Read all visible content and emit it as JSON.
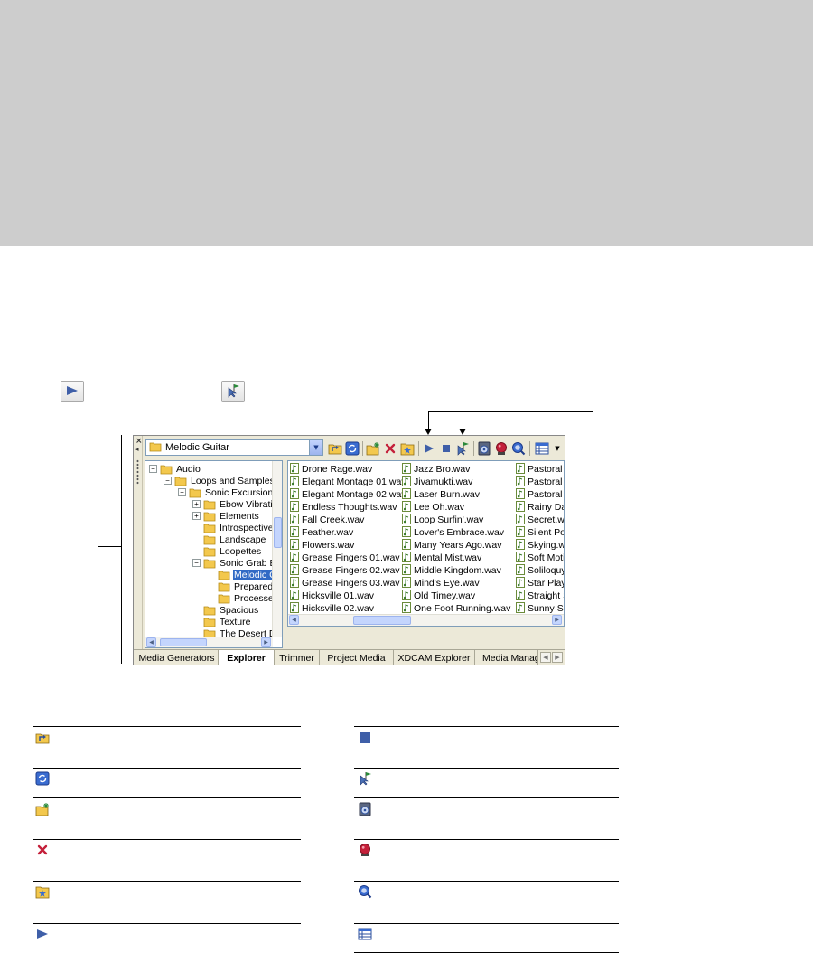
{
  "explorer": {
    "path": "Melodic Guitar",
    "tree": [
      {
        "label": "Audio",
        "expander": "⊟"
      },
      {
        "label": "Loops and Samples",
        "expander": "⊟"
      },
      {
        "label": "Sonic Excursions fo",
        "expander": "⊟"
      },
      {
        "label": "Ebow Vibration",
        "expander": "⊞"
      },
      {
        "label": "Elements",
        "expander": "⊞"
      },
      {
        "label": "Introspective",
        "expander": ""
      },
      {
        "label": "Landscape",
        "expander": ""
      },
      {
        "label": "Loopettes",
        "expander": ""
      },
      {
        "label": "Sonic Grab Bag",
        "expander": "⊟"
      },
      {
        "label": "Melodic Gu",
        "expander": ""
      },
      {
        "label": "Prepared G",
        "expander": ""
      },
      {
        "label": "Processed",
        "expander": ""
      },
      {
        "label": "Spacious",
        "expander": ""
      },
      {
        "label": "Texture",
        "expander": ""
      },
      {
        "label": "The Desert Dw",
        "expander": ""
      }
    ],
    "files_col1": [
      "Drone Rage.wav",
      "Elegant Montage 01.wav",
      "Elegant Montage 02.wav",
      "Endless Thoughts.wav",
      "Fall Creek.wav",
      "Feather.wav",
      "Flowers.wav",
      "Grease Fingers 01.wav",
      "Grease Fingers 02.wav",
      "Grease Fingers 03.wav",
      "Hicksville 01.wav",
      "Hicksville 02.wav"
    ],
    "files_col2": [
      "Jazz Bro.wav",
      "Jivamukti.wav",
      "Laser Burn.wav",
      "Lee Oh.wav",
      "Loop Surfin'.wav",
      "Lover's Embrace.wav",
      "Many Years Ago.wav",
      "Mental Mist.wav",
      "Middle Kingdom.wav",
      "Mind's Eye.wav",
      "Old Timey.wav",
      "One Foot Running.wav"
    ],
    "files_col3": [
      "Pastoral I",
      "Pastoral I",
      "Pastoral I",
      "Rainy Day",
      "Secret.w",
      "Silent Po",
      "Skying.w",
      "Soft Moti",
      "Soliloquy",
      "Star Play",
      "Straight S",
      "Sunny Sic"
    ],
    "tabs": [
      "Media Generators",
      "Explorer",
      "Trimmer",
      "Project Media",
      "XDCAM Explorer",
      "Media Manage"
    ]
  },
  "legend_left_icons": [
    "up-one-level-icon",
    "refresh-icon",
    "new-folder-icon",
    "delete-icon",
    "add-to-favorites-icon",
    "start-preview-icon"
  ],
  "legend_right_icons": [
    "stop-preview-icon",
    "auto-preview-icon",
    "get-media-icon",
    "capture-icon",
    "search-icon",
    "views-icon"
  ],
  "colors": {
    "header_gray": "#cdcdcd",
    "selection": "#316ac5",
    "folder": "#f3c84d"
  }
}
